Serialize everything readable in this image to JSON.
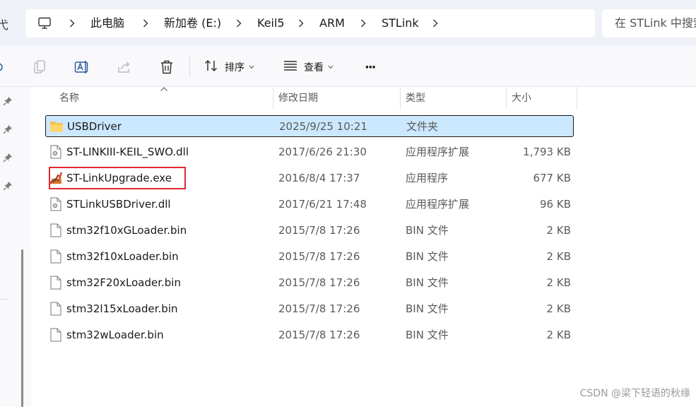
{
  "address_bar": {
    "cut_char": "弋",
    "crumbs": [
      "此电脑",
      "新加卷 (E:)",
      "Keil5",
      "ARM",
      "STLink"
    ],
    "search_placeholder": "在 STLink 中搜索"
  },
  "toolbar": {
    "sort_label": "排序",
    "view_label": "查看",
    "more_label": "···"
  },
  "columns": {
    "name": "名称",
    "date": "修改日期",
    "type": "类型",
    "size": "大小"
  },
  "files": [
    {
      "name": "USBDriver",
      "date": "2025/9/25 10:21",
      "type": "文件夹",
      "size": "",
      "icon": "folder-icon",
      "selected": true
    },
    {
      "name": "ST-LINKIII-KEIL_SWO.dll",
      "date": "2017/6/26 21:30",
      "type": "应用程序扩展",
      "size": "1,793 KB",
      "icon": "dll-file-icon"
    },
    {
      "name": "ST-LinkUpgrade.exe",
      "date": "2016/8/4 17:37",
      "type": "应用程序",
      "size": "677 KB",
      "icon": "exe-app-icon",
      "highlighted": true
    },
    {
      "name": "STLinkUSBDriver.dll",
      "date": "2017/6/21 17:48",
      "type": "应用程序扩展",
      "size": "96 KB",
      "icon": "dll-file-icon"
    },
    {
      "name": "stm32f10xGLoader.bin",
      "date": "2015/7/8 17:26",
      "type": "BIN 文件",
      "size": "2 KB",
      "icon": "bin-file-icon"
    },
    {
      "name": "stm32f10xLoader.bin",
      "date": "2015/7/8 17:26",
      "type": "BIN 文件",
      "size": "2 KB",
      "icon": "bin-file-icon"
    },
    {
      "name": "stm32F20xLoader.bin",
      "date": "2015/7/8 17:26",
      "type": "BIN 文件",
      "size": "2 KB",
      "icon": "bin-file-icon"
    },
    {
      "name": "stm32l15xLoader.bin",
      "date": "2015/7/8 17:26",
      "type": "BIN 文件",
      "size": "2 KB",
      "icon": "bin-file-icon"
    },
    {
      "name": "stm32wLoader.bin",
      "date": "2015/7/8 17:26",
      "type": "BIN 文件",
      "size": "2 KB",
      "icon": "bin-file-icon"
    }
  ],
  "watermark": "CSDN @梁下轻语的秋缘",
  "colors": {
    "selection_bg": "#cce8ff",
    "highlight_border": "#e0282e",
    "folder": "#f4c24c",
    "addr_bg": "#eef1f8"
  }
}
